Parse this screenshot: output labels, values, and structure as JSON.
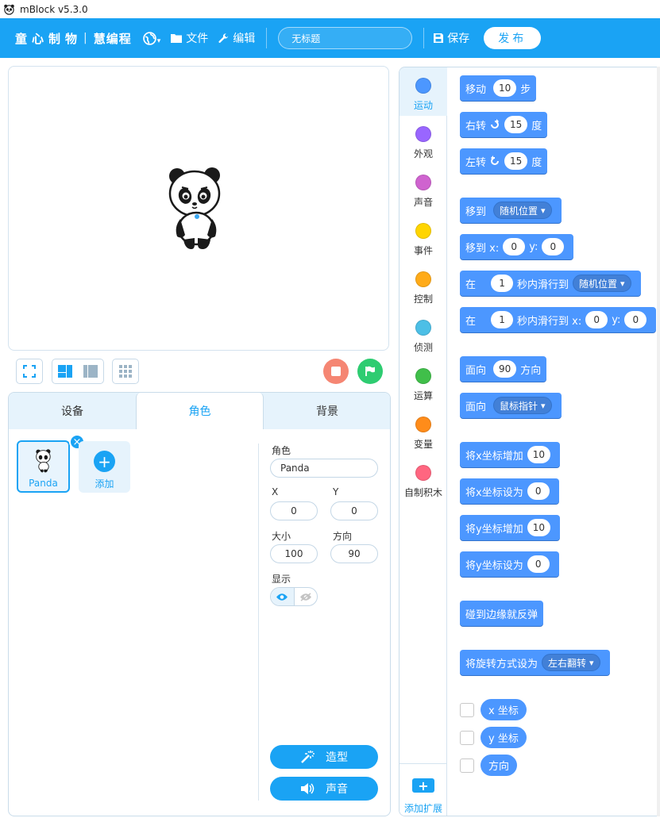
{
  "app": {
    "title": "mBlock v5.3.0"
  },
  "menubar": {
    "brand": "童心制物",
    "brand_sep": "|",
    "brand2": "慧编程",
    "file": "文件",
    "edit": "编辑",
    "project_name": "无标题",
    "save": "保存",
    "publish": "发布"
  },
  "tabs": {
    "devices": "设备",
    "sprites": "角色",
    "backdrops": "背景"
  },
  "sprite_list": {
    "sprite_name": "Panda",
    "add_label": "添加",
    "close": "×"
  },
  "props": {
    "sprite_label": "角色",
    "sprite_value": "Panda",
    "x_label": "X",
    "x_value": "0",
    "y_label": "Y",
    "y_value": "0",
    "size_label": "大小",
    "size_value": "100",
    "dir_label": "方向",
    "dir_value": "90",
    "show_label": "显示",
    "costume_button": "造型",
    "sound_button": "声音"
  },
  "categories": [
    {
      "label": "运动",
      "color": "#4c97ff"
    },
    {
      "label": "外观",
      "color": "#9966ff"
    },
    {
      "label": "声音",
      "color": "#cf63cf"
    },
    {
      "label": "事件",
      "color": "#ffd500"
    },
    {
      "label": "控制",
      "color": "#ffab19"
    },
    {
      "label": "侦测",
      "color": "#4cbfe6"
    },
    {
      "label": "运算",
      "color": "#40bf4a"
    },
    {
      "label": "变量",
      "color": "#ff8c1a"
    },
    {
      "label": "自制积木",
      "color": "#ff6680"
    }
  ],
  "add_extension": "添加扩展",
  "blocks": {
    "move": [
      "移动",
      "10",
      "步"
    ],
    "turn_right": [
      "右转",
      "15",
      "度"
    ],
    "turn_left": [
      "左转",
      "15",
      "度"
    ],
    "goto": [
      "移到",
      "随机位置"
    ],
    "goto_xy": [
      "移到 x:",
      "0",
      "y:",
      "0"
    ],
    "glide": [
      "在",
      "1",
      "秒内滑行到",
      "随机位置"
    ],
    "glide_xy": [
      "在",
      "1",
      "秒内滑行到 x:",
      "0",
      "y:",
      "0"
    ],
    "point_dir": [
      "面向",
      "90",
      "方向"
    ],
    "point_towards": [
      "面向",
      "鼠标指针"
    ],
    "change_x": [
      "将x坐标增加",
      "10"
    ],
    "set_x": [
      "将x坐标设为",
      "0"
    ],
    "change_y": [
      "将y坐标增加",
      "10"
    ],
    "set_y": [
      "将y坐标设为",
      "0"
    ],
    "bounce": [
      "碰到边缘就反弹"
    ],
    "rotation_style": [
      "将旋转方式设为",
      "左右翻转"
    ],
    "reporters": [
      "x 坐标",
      "y 坐标",
      "方向"
    ]
  },
  "colors": {
    "accent": "#1aa3f4",
    "motion": "#4c97ff",
    "stop": "#f58673",
    "go": "#2ecc71"
  }
}
